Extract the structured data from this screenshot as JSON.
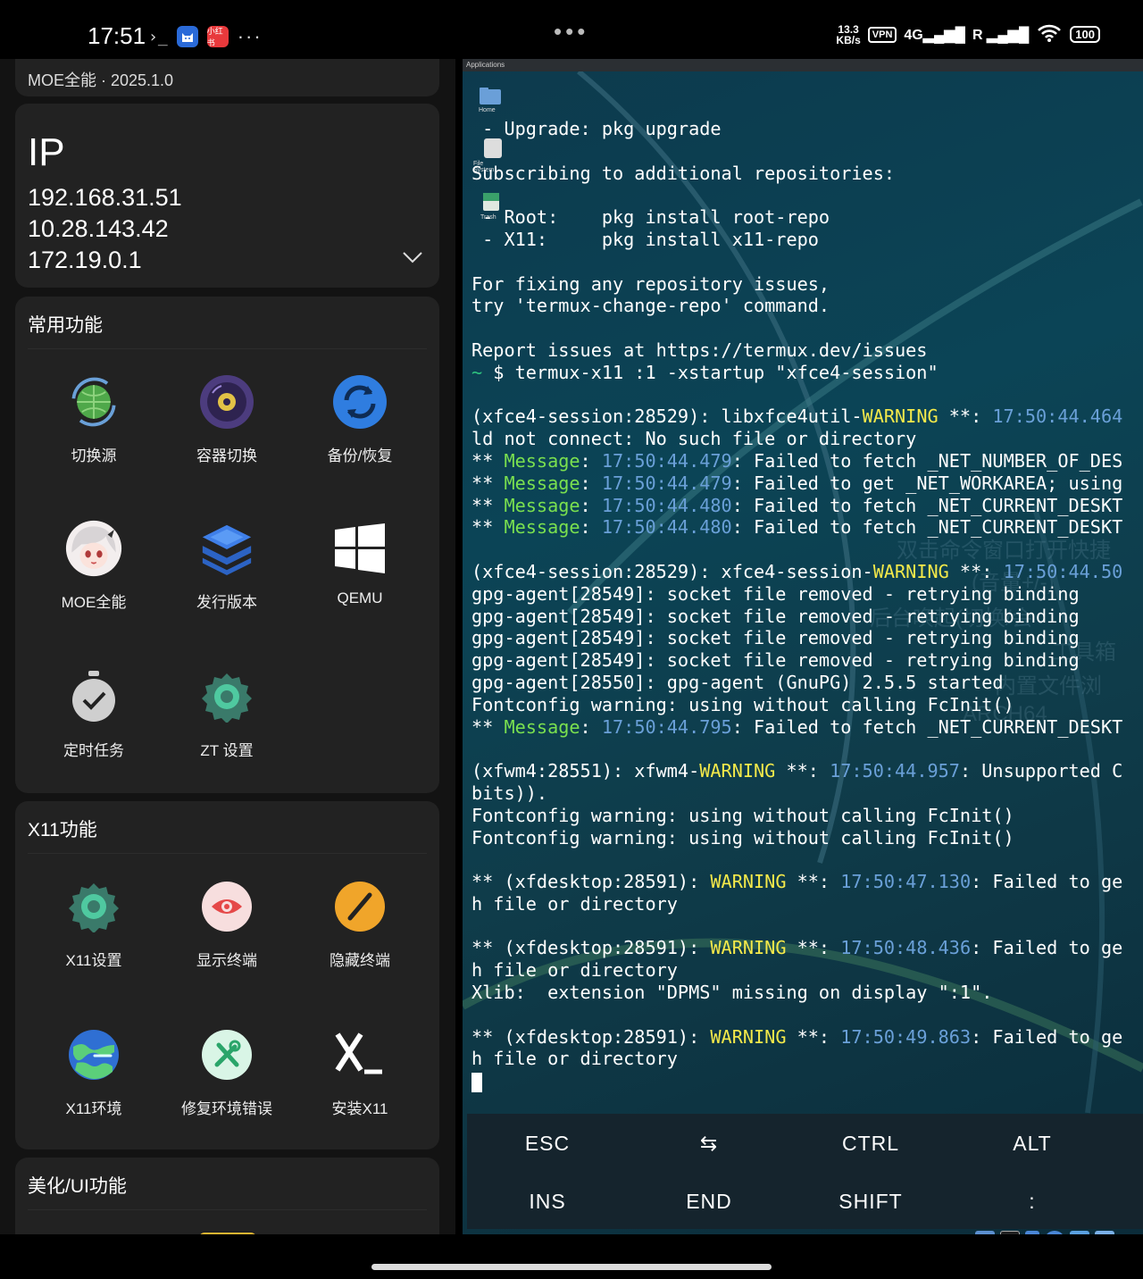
{
  "status_bar": {
    "time": "17:51",
    "terminal_glyph": "›_",
    "app1_icon": "cat-app-icon",
    "app2_label": "小红书",
    "more": "···",
    "center_dots": "•••",
    "net_speed_value": "13.3",
    "net_speed_unit": "KB/s",
    "vpn": "VPN",
    "network": "4G",
    "signal1": "▂▄▆█",
    "signal2": "R ▂▄▆█",
    "wifi": "wifi-icon",
    "battery": "100"
  },
  "left": {
    "top_card_partial": "MOE全能 · 2025.1.0",
    "ip_card": {
      "title": "IP",
      "addresses": [
        "192.168.31.51",
        "10.28.143.42",
        "172.19.0.1"
      ]
    },
    "common": {
      "title": "常用功能",
      "items": [
        {
          "label": "切换源",
          "icon": "globe-switch-icon"
        },
        {
          "label": "容器切换",
          "icon": "disc-icon"
        },
        {
          "label": "备份/恢复",
          "icon": "sync-icon"
        },
        {
          "label": "MOE全能",
          "icon": "anime-avatar-icon"
        },
        {
          "label": "发行版本",
          "icon": "layers-icon"
        },
        {
          "label": "QEMU",
          "icon": "windows-icon"
        },
        {
          "label": "定时任务",
          "icon": "stopwatch-check-icon"
        },
        {
          "label": "ZT 设置",
          "icon": "gear-icon"
        }
      ]
    },
    "x11": {
      "title": "X11功能",
      "items": [
        {
          "label": "X11设置",
          "icon": "gear-icon"
        },
        {
          "label": "显示终端",
          "icon": "eye-icon"
        },
        {
          "label": "隐藏终端",
          "icon": "slash-icon"
        },
        {
          "label": "X11环境",
          "icon": "earth-icon"
        },
        {
          "label": "修复环境错误",
          "icon": "tools-icon"
        },
        {
          "label": "安装X11",
          "icon": "x-terminal-icon"
        }
      ]
    },
    "beauty": {
      "title": "美化/UI功能"
    }
  },
  "right": {
    "panel_menu": "Applications",
    "desktop_icons": [
      "Home",
      "File System",
      "Trash"
    ],
    "terminal_lines": [
      [
        {
          "t": " - Upgrade: pkg upgrade"
        }
      ],
      [
        {
          "t": ""
        }
      ],
      [
        {
          "t": "Subscribing to additional repositories:"
        }
      ],
      [
        {
          "t": ""
        }
      ],
      [
        {
          "t": " - Root:    pkg install root-repo"
        }
      ],
      [
        {
          "t": " - X11:     pkg install x11-repo"
        }
      ],
      [
        {
          "t": ""
        }
      ],
      [
        {
          "t": "For fixing any repository issues,"
        }
      ],
      [
        {
          "t": "try 'termux-change-repo' command."
        }
      ],
      [
        {
          "t": ""
        }
      ],
      [
        {
          "t": "Report issues at https://termux.dev/issues"
        }
      ],
      [
        {
          "t": "~",
          "c": "gp"
        },
        {
          "t": " $ termux-x11 :1 -xstartup \"xfce4-session\""
        }
      ],
      [
        {
          "t": ""
        }
      ],
      [
        {
          "t": "(xfce4-session:28529): libxfce4util-"
        },
        {
          "t": "WARNING",
          "c": "y"
        },
        {
          "t": " **: "
        },
        {
          "t": "17:50:44.464",
          "c": "b"
        }
      ],
      [
        {
          "t": "ld not connect: No such file or directory"
        }
      ],
      [
        {
          "t": "** "
        },
        {
          "t": "Message",
          "c": "g"
        },
        {
          "t": ": "
        },
        {
          "t": "17:50:44.479",
          "c": "b"
        },
        {
          "t": ": Failed to fetch _NET_NUMBER_OF_DES"
        }
      ],
      [
        {
          "t": "** "
        },
        {
          "t": "Message",
          "c": "g"
        },
        {
          "t": ": "
        },
        {
          "t": "17:50:44.479",
          "c": "b"
        },
        {
          "t": ": Failed to get _NET_WORKAREA; using"
        }
      ],
      [
        {
          "t": "** "
        },
        {
          "t": "Message",
          "c": "g"
        },
        {
          "t": ": "
        },
        {
          "t": "17:50:44.480",
          "c": "b"
        },
        {
          "t": ": Failed to fetch _NET_CURRENT_DESKT"
        }
      ],
      [
        {
          "t": "** "
        },
        {
          "t": "Message",
          "c": "g"
        },
        {
          "t": ": "
        },
        {
          "t": "17:50:44.480",
          "c": "b"
        },
        {
          "t": ": Failed to fetch _NET_CURRENT_DESKT"
        }
      ],
      [
        {
          "t": ""
        }
      ],
      [
        {
          "t": "(xfce4-session:28529): xfce4-session-"
        },
        {
          "t": "WARNING",
          "c": "y"
        },
        {
          "t": " **: "
        },
        {
          "t": "17:50:44.50",
          "c": "b"
        }
      ],
      [
        {
          "t": "gpg-agent[28549]: socket file removed - retrying binding"
        }
      ],
      [
        {
          "t": "gpg-agent[28549]: socket file removed - retrying binding"
        }
      ],
      [
        {
          "t": "gpg-agent[28549]: socket file removed - retrying binding"
        }
      ],
      [
        {
          "t": "gpg-agent[28549]: socket file removed - retrying binding"
        }
      ],
      [
        {
          "t": "gpg-agent[28550]: gpg-agent (GnuPG) 2.5.5 started"
        }
      ],
      [
        {
          "t": "Fontconfig warning: using without calling FcInit()"
        }
      ],
      [
        {
          "t": "** "
        },
        {
          "t": "Message",
          "c": "g"
        },
        {
          "t": ": "
        },
        {
          "t": "17:50:44.795",
          "c": "b"
        },
        {
          "t": ": Failed to fetch _NET_CURRENT_DESKT"
        }
      ],
      [
        {
          "t": ""
        }
      ],
      [
        {
          "t": "(xfwm4:28551): xfwm4-"
        },
        {
          "t": "WARNING",
          "c": "y"
        },
        {
          "t": " **: "
        },
        {
          "t": "17:50:44.957",
          "c": "b"
        },
        {
          "t": ": Unsupported C"
        }
      ],
      [
        {
          "t": "bits))."
        }
      ],
      [
        {
          "t": "Fontconfig warning: using without calling FcInit()"
        }
      ],
      [
        {
          "t": "Fontconfig warning: using without calling FcInit()"
        }
      ],
      [
        {
          "t": ""
        }
      ],
      [
        {
          "t": "** (xfdesktop:28591): "
        },
        {
          "t": "WARNING",
          "c": "y"
        },
        {
          "t": " **: "
        },
        {
          "t": "17:50:47.130",
          "c": "b"
        },
        {
          "t": ": Failed to ge"
        }
      ],
      [
        {
          "t": "h file or directory"
        }
      ],
      [
        {
          "t": ""
        }
      ],
      [
        {
          "t": "** (xfdesktop:28591): "
        },
        {
          "t": "WARNING",
          "c": "y"
        },
        {
          "t": " **: "
        },
        {
          "t": "17:50:48.436",
          "c": "b"
        },
        {
          "t": ": Failed to ge"
        }
      ],
      [
        {
          "t": "h file or directory"
        }
      ],
      [
        {
          "t": "Xlib:  extension \"DPMS\" missing on display \":1\"."
        }
      ],
      [
        {
          "t": ""
        }
      ],
      [
        {
          "t": "** (xfdesktop:28591): "
        },
        {
          "t": "WARNING",
          "c": "y"
        },
        {
          "t": " **: "
        },
        {
          "t": "17:50:49.863",
          "c": "b"
        },
        {
          "t": ": Failed to ge"
        }
      ],
      [
        {
          "t": "h file or directory"
        }
      ]
    ],
    "watermark_lines": [
      "双击命令窗口打开快捷",
      "(音量+/-)",
      "后台唤起(切换/会",
      "工具箱",
      "内置文件浏",
      "ARCH64"
    ],
    "extra_keys": {
      "row1": [
        "ESC",
        "⇆",
        "CTRL",
        "ALT"
      ],
      "row2": [
        "INS",
        "END",
        "SHIFT",
        ":"
      ]
    }
  },
  "colors": {
    "warning": "#f4e94a",
    "message": "#7ae04f",
    "timestamp": "#6aa0d8",
    "card_bg": "#222222",
    "terminal_bg": "#0d3a4d"
  }
}
